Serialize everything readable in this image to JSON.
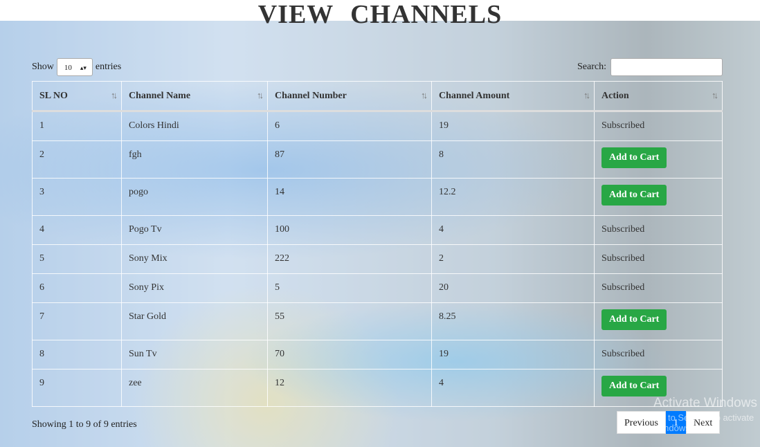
{
  "page": {
    "title": "VIEW  CHANNELS"
  },
  "length_control": {
    "prefix": "Show",
    "value": "10",
    "suffix": "entries"
  },
  "search": {
    "label": "Search:",
    "value": ""
  },
  "table": {
    "columns": [
      "SL NO",
      "Channel Name",
      "Channel Number",
      "Channel Amount",
      "Action"
    ],
    "rows": [
      {
        "sl": "1",
        "name": "Colors Hindi",
        "number": "6",
        "amount": "19",
        "action": "Subscribed",
        "button": false
      },
      {
        "sl": "2",
        "name": "fgh",
        "number": "87",
        "amount": "8",
        "action": "Add to Cart",
        "button": true
      },
      {
        "sl": "3",
        "name": "pogo",
        "number": "14",
        "amount": "12.2",
        "action": "Add to Cart",
        "button": true
      },
      {
        "sl": "4",
        "name": "Pogo Tv",
        "number": "100",
        "amount": "4",
        "action": "Subscribed",
        "button": false
      },
      {
        "sl": "5",
        "name": "Sony Mix",
        "number": "222",
        "amount": "2",
        "action": "Subscribed",
        "button": false
      },
      {
        "sl": "6",
        "name": "Sony Pix",
        "number": "5",
        "amount": "20",
        "action": "Subscribed",
        "button": false
      },
      {
        "sl": "7",
        "name": "Star Gold",
        "number": "55",
        "amount": "8.25",
        "action": "Add to Cart",
        "button": true
      },
      {
        "sl": "8",
        "name": "Sun Tv",
        "number": "70",
        "amount": "19",
        "action": "Subscribed",
        "button": false
      },
      {
        "sl": "9",
        "name": "zee",
        "number": "12",
        "amount": "4",
        "action": "Add to Cart",
        "button": true
      }
    ]
  },
  "info": "Showing 1 to 9 of 9 entries",
  "pagination": {
    "previous": "Previous",
    "current": "1",
    "next": "Next"
  },
  "watermark": {
    "line1": "Activate Windows",
    "line2": "Go to Settings to activate Windows."
  }
}
